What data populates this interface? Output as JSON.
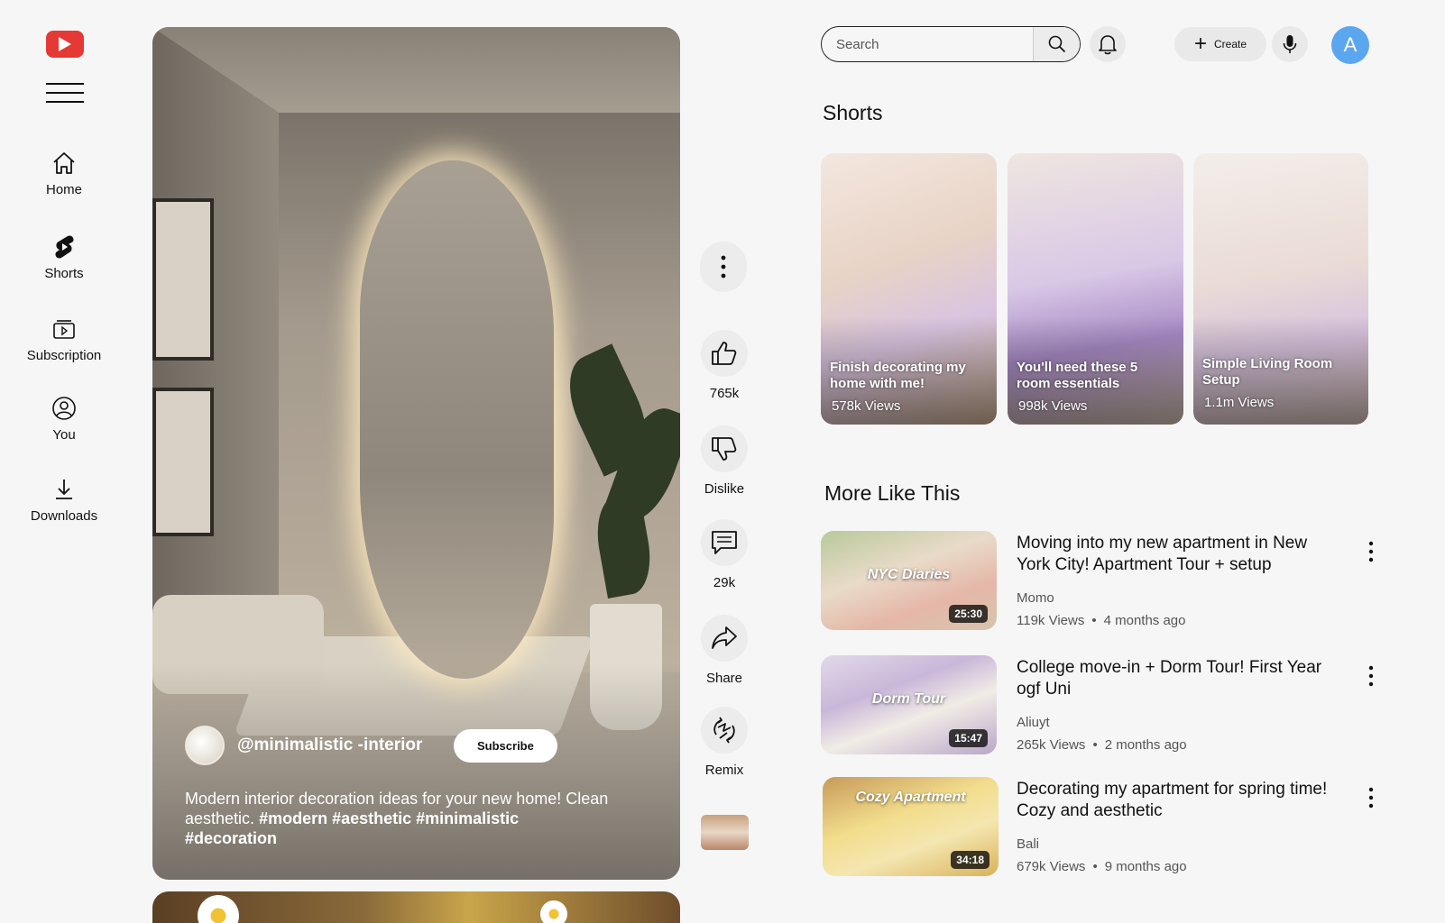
{
  "sidebar": {
    "items": [
      {
        "label": "Home",
        "icon": "home-icon"
      },
      {
        "label": "Shorts",
        "icon": "shorts-icon"
      },
      {
        "label": "Subscription",
        "icon": "subscription-icon"
      },
      {
        "label": "You",
        "icon": "user-icon"
      },
      {
        "label": "Downloads",
        "icon": "download-icon"
      }
    ]
  },
  "colors": {
    "brand": "#e53935",
    "avatar": "#5aa7ef"
  },
  "short": {
    "channel": "@minimalistic -interior",
    "subscribe": "Subscribe",
    "description": "Modern interior decoration ideas for your new home! Clean aesthetic.",
    "hashtags": "#modern #aesthetic #minimalistic #decoration"
  },
  "actions": {
    "likes": "765k",
    "dislike": "Dislike",
    "comments": "29k",
    "share": "Share",
    "remix": "Remix"
  },
  "topbar": {
    "search_placeholder": "Search",
    "create": "Create",
    "avatar_letter": "A"
  },
  "shorts_section": {
    "title": "Shorts",
    "items": [
      {
        "title": "Finish decorating my home with me!",
        "views": "578k Views"
      },
      {
        "title": "You'll need these 5 room essentials",
        "views": "998k Views"
      },
      {
        "title": "Simple Living Room Setup",
        "views": "1.1m Views"
      }
    ]
  },
  "more_section": {
    "title": "More Like This",
    "videos": [
      {
        "thumb_label": "NYC Diaries",
        "duration": "25:30",
        "title": "Moving into my new apartment in New York City! Apartment Tour + setup",
        "channel": "Momo",
        "views": "119k Views",
        "age": "4 months ago"
      },
      {
        "thumb_label": "Dorm Tour",
        "duration": "15:47",
        "title": "College move-in + Dorm Tour! First Year ogf Uni",
        "channel": "Aliuyt",
        "views": "265k Views",
        "age": "2 months ago"
      },
      {
        "thumb_label": "Cozy Apartment",
        "duration": "34:18",
        "title": "Decorating my apartment for spring time! Cozy and aesthetic",
        "channel": "Bali",
        "views": "679k Views",
        "age": "9 months ago"
      }
    ]
  }
}
